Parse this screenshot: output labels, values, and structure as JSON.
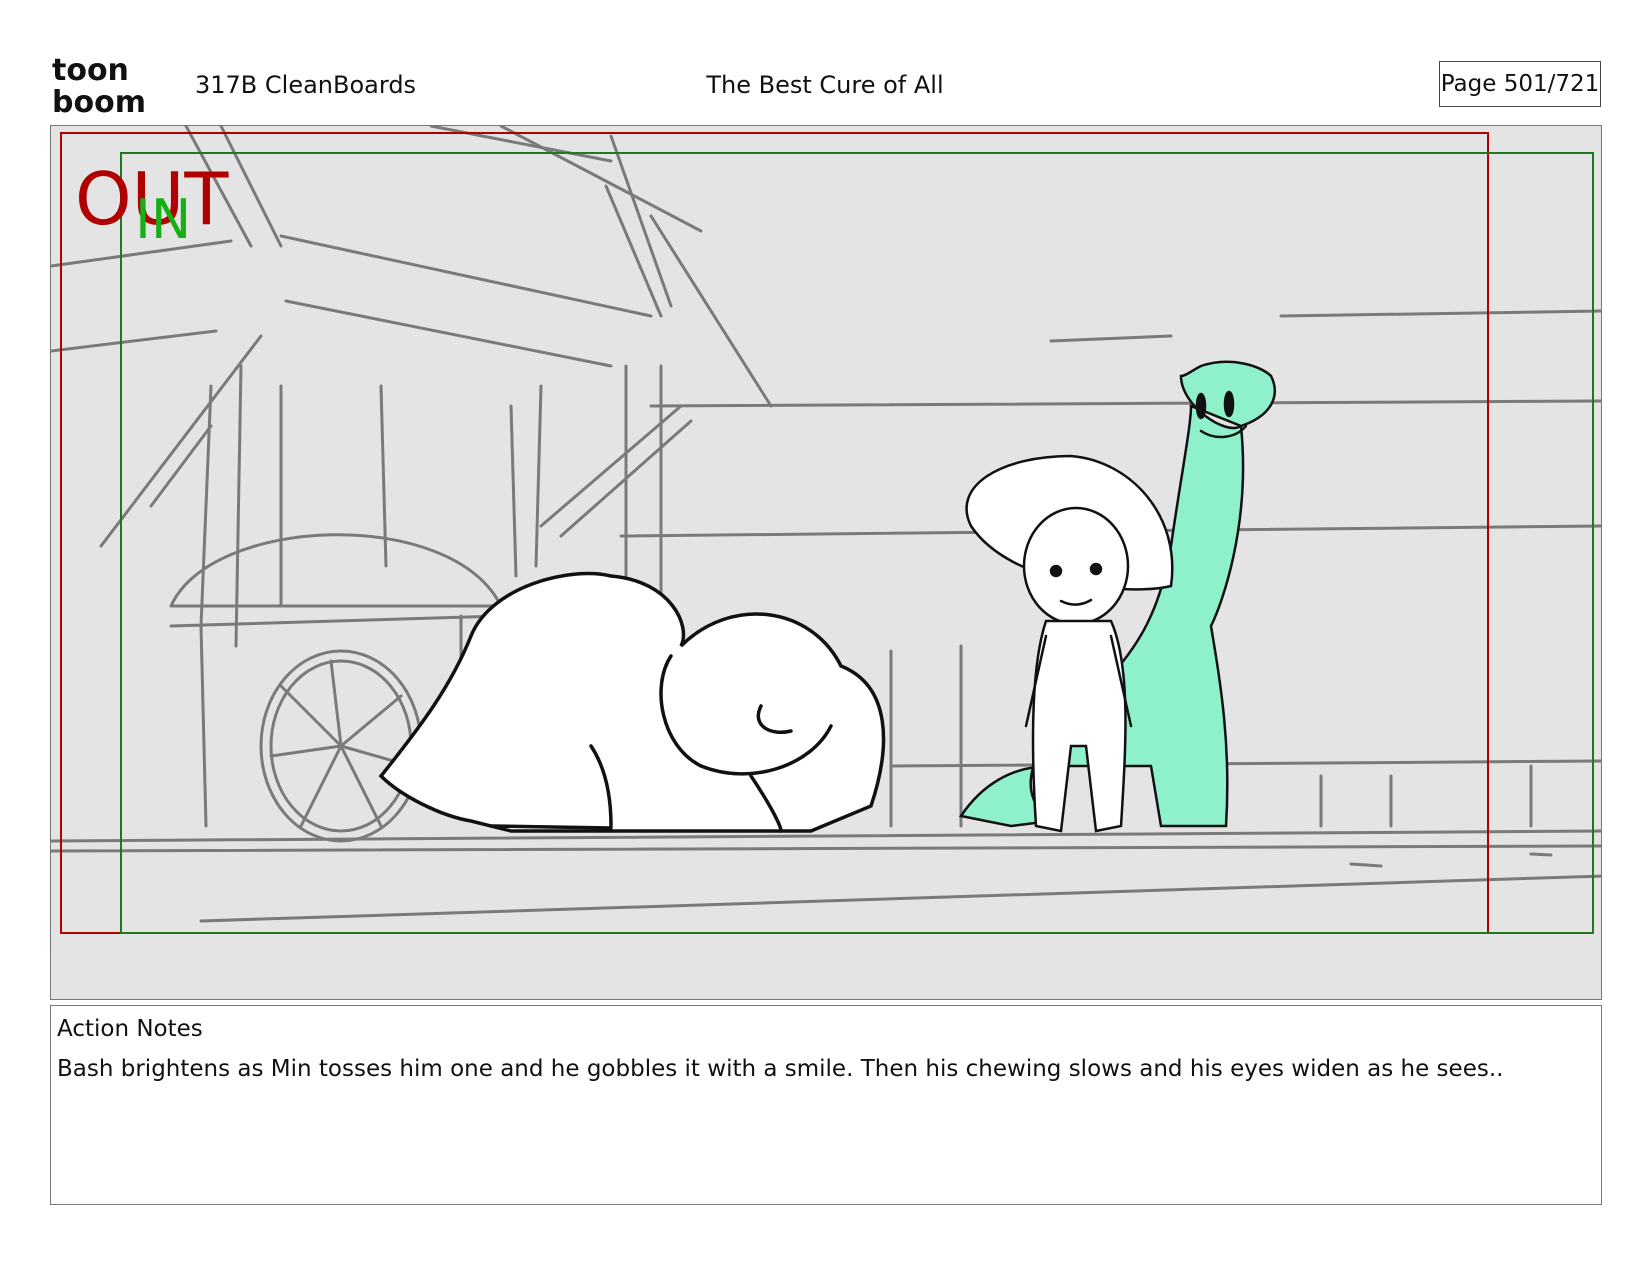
{
  "header": {
    "logo_text_top": "toon",
    "logo_text_bottom": "boom",
    "scene_id": "317B  CleanBoards",
    "title": "The Best Cure of All",
    "page": "Page 501/721"
  },
  "panel": {
    "out_label": "OUT",
    "in_label": "IN",
    "out_frame_color": "#b00000",
    "in_frame_color": "#1f7a1f",
    "dino_color": "#8ff0cc"
  },
  "notes": {
    "heading": "Action Notes",
    "text": "Bash brightens as Min tosses him one and he gobbles it with a smile. Then his chewing slows and his eyes widen as he sees.."
  }
}
